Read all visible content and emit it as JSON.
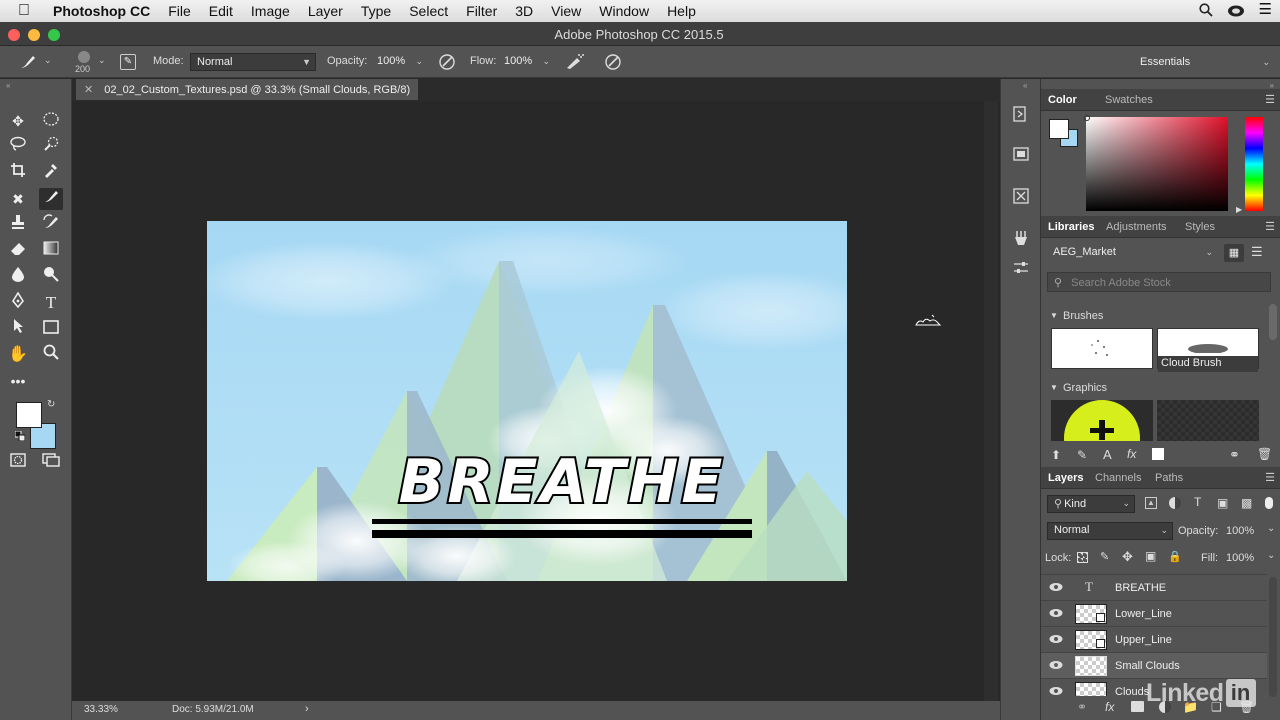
{
  "menubar": {
    "app": "Photoshop CC",
    "items": [
      "File",
      "Edit",
      "Image",
      "Layer",
      "Type",
      "Select",
      "Filter",
      "3D",
      "View",
      "Window",
      "Help"
    ]
  },
  "window": {
    "title": "Adobe Photoshop CC 2015.5"
  },
  "options": {
    "brush_size": "200",
    "mode_label": "Mode:",
    "mode_value": "Normal",
    "opacity_label": "Opacity:",
    "opacity_value": "100%",
    "flow_label": "Flow:",
    "flow_value": "100%",
    "workspace": "Essentials"
  },
  "document": {
    "tab_title": "02_02_Custom_Textures.psd @ 33.3% (Small Clouds, RGB/8)",
    "artwork_text": "BREATHE",
    "zoom": "33.33%",
    "doc_size": "Doc: 5.93M/21.0M"
  },
  "color_panel": {
    "tab_color": "Color",
    "tab_swatches": "Swatches"
  },
  "libraries_panel": {
    "tabs": [
      "Libraries",
      "Adjustments",
      "Styles"
    ],
    "library_name": "AEG_Market",
    "search_placeholder": "Search Adobe Stock",
    "section_brushes": "Brushes",
    "brush_item_label": "Cloud Brush",
    "section_graphics": "Graphics"
  },
  "layers_panel": {
    "tabs": [
      "Layers",
      "Channels",
      "Paths"
    ],
    "filter_kind": "Kind",
    "blend_mode": "Normal",
    "opacity_label": "Opacity:",
    "opacity_value": "100%",
    "lock_label": "Lock:",
    "fill_label": "Fill:",
    "fill_value": "100%",
    "layers": [
      {
        "name": "BREATHE",
        "type": "text"
      },
      {
        "name": "Lower_Line",
        "type": "smart"
      },
      {
        "name": "Upper_Line",
        "type": "smart"
      },
      {
        "name": "Small Clouds",
        "type": "pixel",
        "selected": true
      },
      {
        "name": "Clouds",
        "type": "pixel"
      }
    ]
  },
  "watermark": "Linked in",
  "colors": {
    "foreground": "#ffffff",
    "background": "#a6d8f4",
    "ui_panel": "#535353",
    "canvas_bg": "#282828",
    "sky": "#a6d8f4"
  }
}
